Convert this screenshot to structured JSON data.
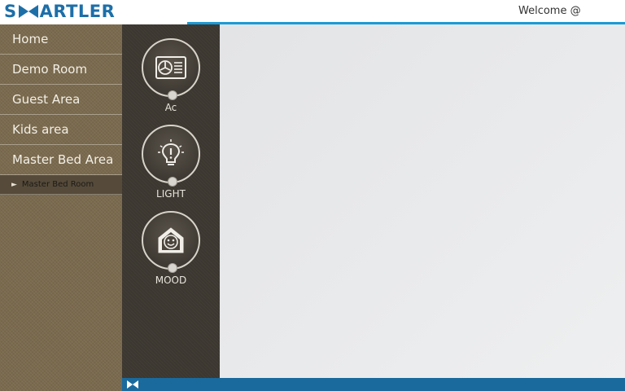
{
  "header": {
    "logo_left": "S",
    "logo_right": "ARTLER",
    "welcome_text": "Welcome @"
  },
  "sidebar": {
    "items": [
      {
        "label": "Home"
      },
      {
        "label": "Demo Room"
      },
      {
        "label": "Guest Area"
      },
      {
        "label": "Kids area"
      },
      {
        "label": "Master Bed Area"
      }
    ],
    "sub_item": {
      "label": "Master Bed Room",
      "icon": "chevron-right-icon"
    }
  },
  "devices": [
    {
      "label": "Ac",
      "icon": "ac-icon"
    },
    {
      "label": "LIGHT",
      "icon": "lightbulb-icon"
    },
    {
      "label": "MOOD",
      "icon": "mood-house-icon"
    }
  ],
  "colors": {
    "accent": "#1a9ad6",
    "brand": "#1d6fa8",
    "footer": "#1a6a9e",
    "sidebar": "#7a6a4e",
    "device_column": "#3c3730"
  }
}
